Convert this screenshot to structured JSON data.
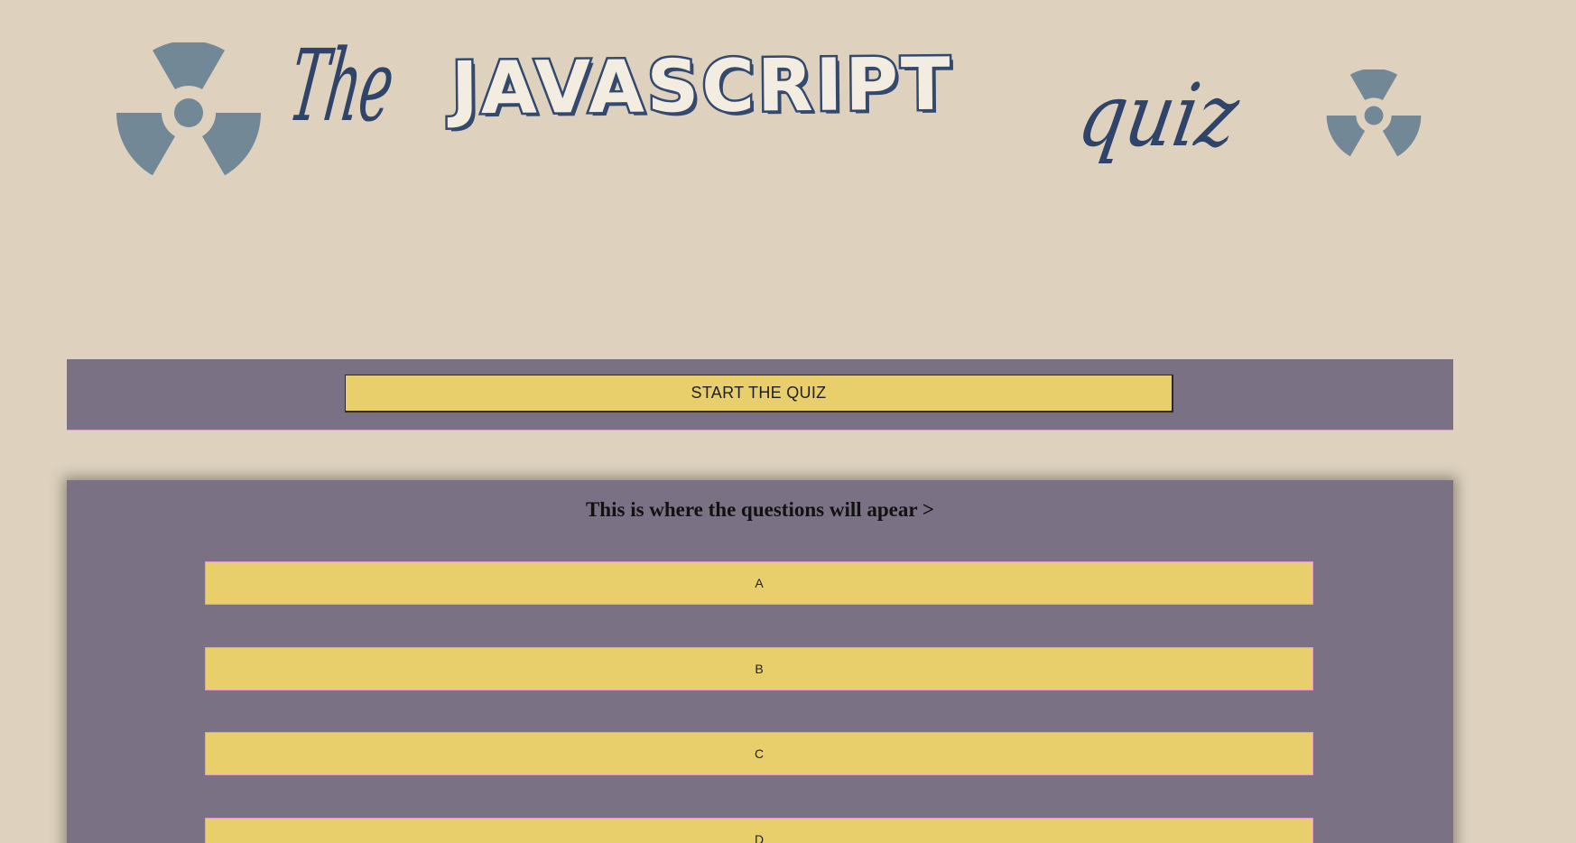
{
  "header": {
    "title_the": "The",
    "title_main": "JAVASCRIPT",
    "title_quiz": "quiz",
    "icons": [
      "radiation-icon",
      "radiation-icon"
    ],
    "icon_color": "#728897",
    "title_color": "#33496e"
  },
  "start": {
    "button_label": "START THE QUIZ"
  },
  "quiz": {
    "question": "This is where the questions will apear >",
    "answers": [
      "A",
      "B",
      "C",
      "D"
    ]
  },
  "colors": {
    "background": "#ded2bf",
    "panel": "#7b7185",
    "button": "#e9cf6b",
    "answer_border": "#e39ad2"
  }
}
